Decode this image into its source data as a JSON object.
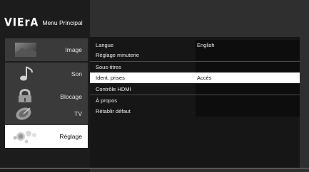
{
  "header": {
    "logo": "VIErA",
    "title": "Menu Principal"
  },
  "sidebar": {
    "items": [
      {
        "label": "Image",
        "icon": "image-icon"
      },
      {
        "label": "Son",
        "icon": "music-note-icon"
      },
      {
        "label": "Blocage",
        "icon": "padlock-icon"
      },
      {
        "label": "TV",
        "icon": "satellite-dish-icon"
      },
      {
        "label": "Réglage",
        "icon": "settings-bubbles-icon",
        "active": true
      }
    ]
  },
  "settings": {
    "rows": [
      {
        "label": "Langue",
        "value": "English"
      },
      {
        "label": "Réglage minuterie",
        "value": ""
      },
      {
        "label": "Sous-titres",
        "value": ""
      },
      {
        "label": "Ident. prises",
        "value": "Accès",
        "selected": true
      },
      {
        "label": "Contrôle HDMI",
        "value": ""
      },
      {
        "label": "À propos",
        "value": ""
      },
      {
        "label": "Rétablir défaut",
        "value": ""
      }
    ]
  }
}
